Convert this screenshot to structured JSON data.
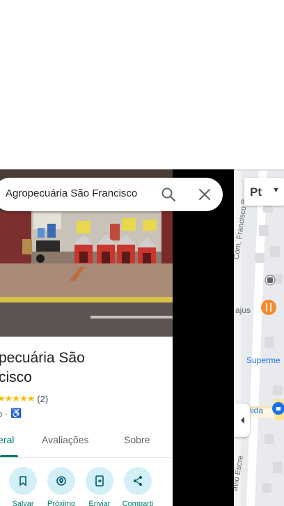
{
  "search": {
    "query": "Agropecuária São Francisco"
  },
  "place": {
    "title_line1": "pecuária São",
    "title_line2": "cisco",
    "stars": "★★★★★",
    "review_count": "(2)",
    "category": "p ·"
  },
  "tabs": [
    {
      "label": "eral"
    },
    {
      "label": "Avaliações"
    },
    {
      "label": "Sobre"
    }
  ],
  "actions": [
    {
      "label": "Salvar",
      "icon": "bookmark-icon"
    },
    {
      "label": "Próximo",
      "icon": "nearby-icon"
    },
    {
      "label": "Enviar",
      "icon": "send-to-phone-icon"
    },
    {
      "label": "Comparti",
      "icon": "share-icon"
    }
  ],
  "map": {
    "layer_button": "Pt",
    "street_1": "Com. Francisco B",
    "street_2": "avio Escre",
    "label_ajus": "ajus",
    "label_supermercado": "Superme",
    "label_mida": "mida"
  },
  "colors": {
    "accent": "#00796b",
    "chip": "#d3f0f7",
    "star": "#fbbc04"
  }
}
